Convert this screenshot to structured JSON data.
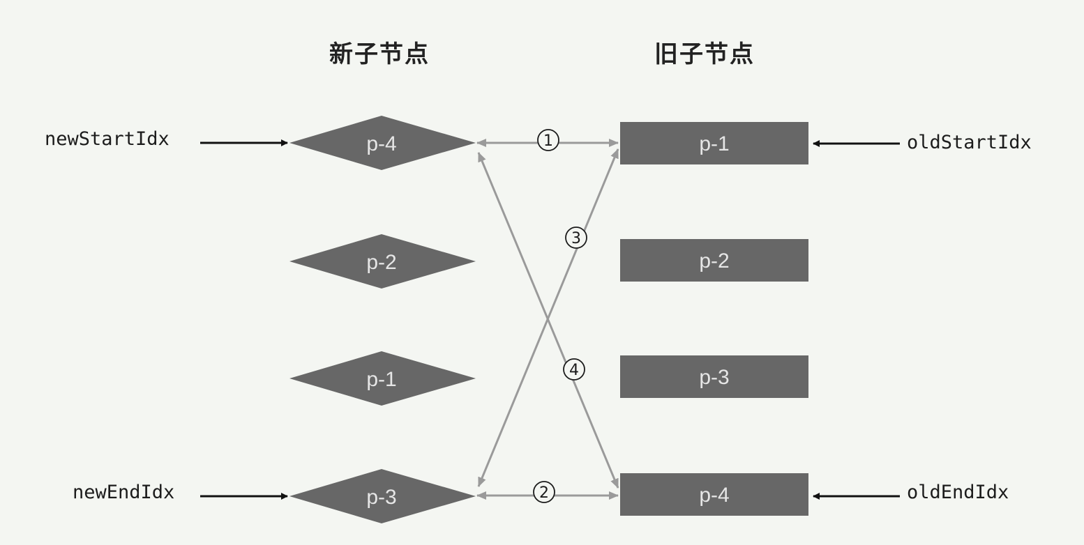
{
  "headings": {
    "new": "新子节点",
    "old": "旧子节点"
  },
  "pointers": {
    "newStartIdx": "newStartIdx",
    "newEndIdx": "newEndIdx",
    "oldStartIdx": "oldStartIdx",
    "oldEndIdx": "oldEndIdx"
  },
  "new_nodes": [
    "p-4",
    "p-2",
    "p-1",
    "p-3"
  ],
  "old_nodes": [
    "p-1",
    "p-2",
    "p-3",
    "p-4"
  ],
  "steps": [
    "1",
    "2",
    "3",
    "4"
  ],
  "colors": {
    "node_fill": "#676767",
    "node_text": "#e6e6e6",
    "compare_line": "#9a9a9a",
    "pointer_arrow": "#111111",
    "background": "#f4f6f2"
  }
}
